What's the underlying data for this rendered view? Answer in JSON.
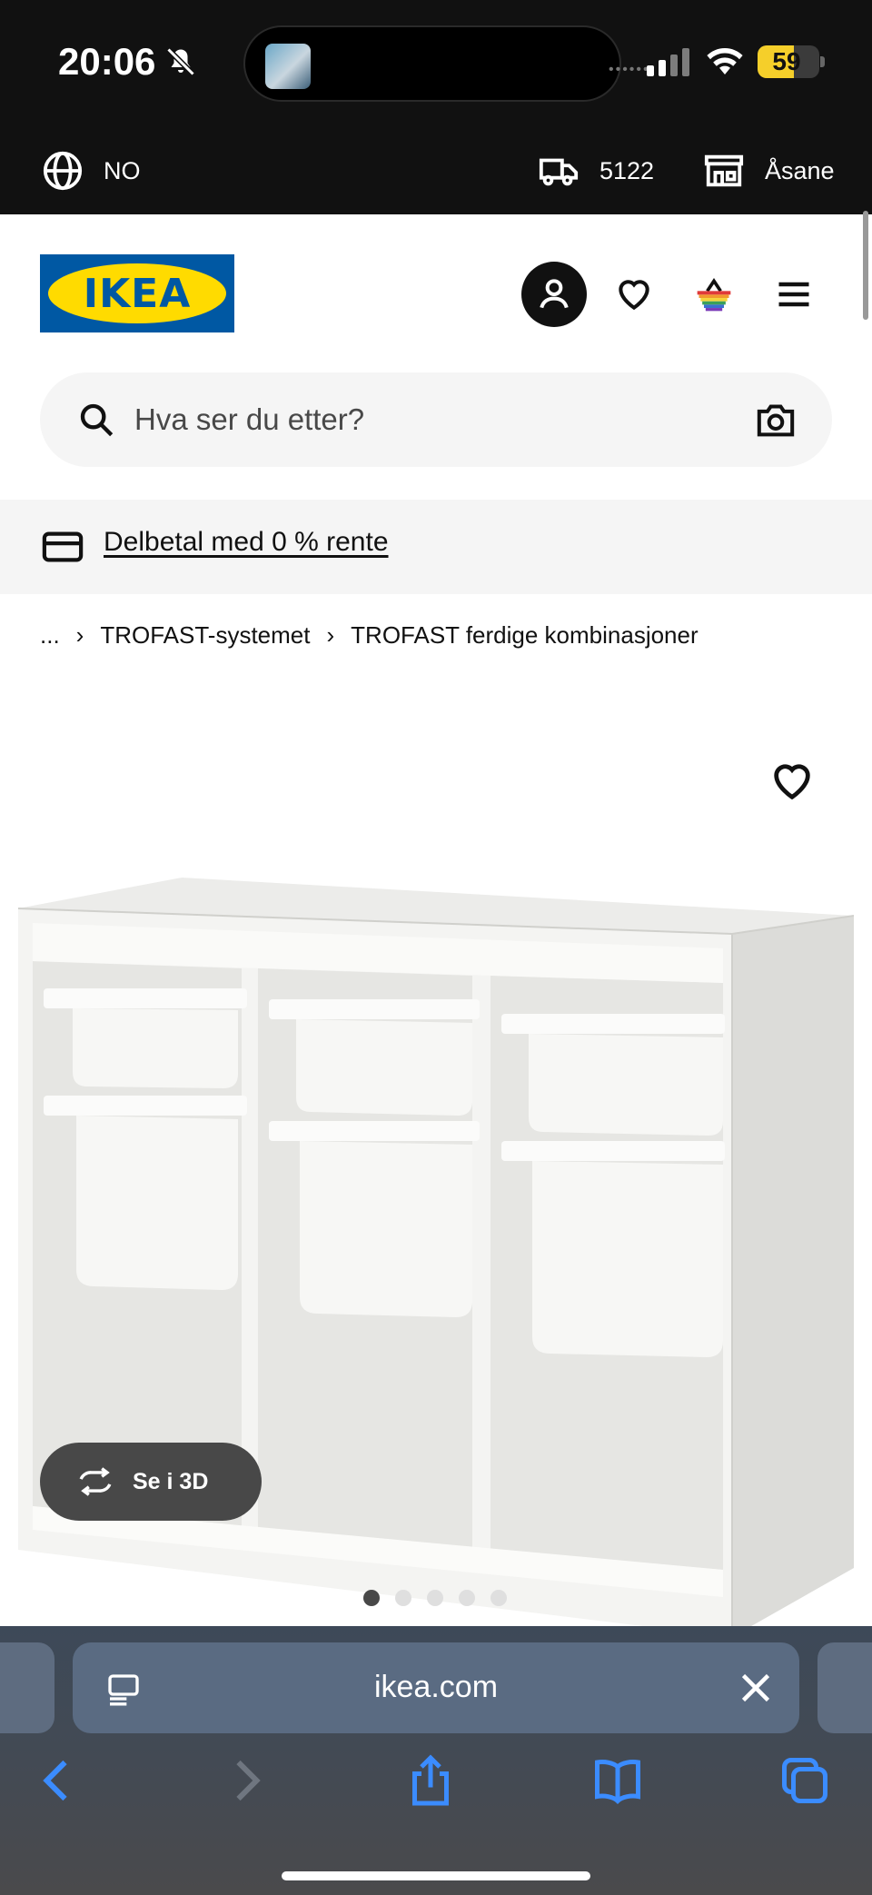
{
  "status_bar": {
    "time": "20:06",
    "battery": "59",
    "battery_level": 0.59
  },
  "topbar": {
    "language": "NO",
    "postcode": "5122",
    "store": "Åsane"
  },
  "search": {
    "placeholder": "Hva ser du etter?"
  },
  "promo": {
    "text": "Delbetal med 0 % rente"
  },
  "breadcrumb": {
    "ellipsis": "...",
    "items": [
      "TROFAST-systemet",
      "TROFAST ferdige kombinasjoner"
    ],
    "separator": "›"
  },
  "product": {
    "view_3d_label": "Se i 3D",
    "carousel": {
      "count": 5,
      "active": 1
    }
  },
  "browser": {
    "url": "ikea.com"
  },
  "icons": {
    "language": "globe-icon",
    "delivery": "truck-icon",
    "store": "store-icon",
    "account": "user-icon",
    "favourites": "heart-icon",
    "cart": "basket-icon",
    "menu": "hamburger-menu-icon",
    "search": "search-icon",
    "camera": "camera-icon",
    "payment": "credit-card-icon"
  },
  "colors": {
    "brand_blue": "#0058a3",
    "brand_yellow": "#ffdb00"
  }
}
